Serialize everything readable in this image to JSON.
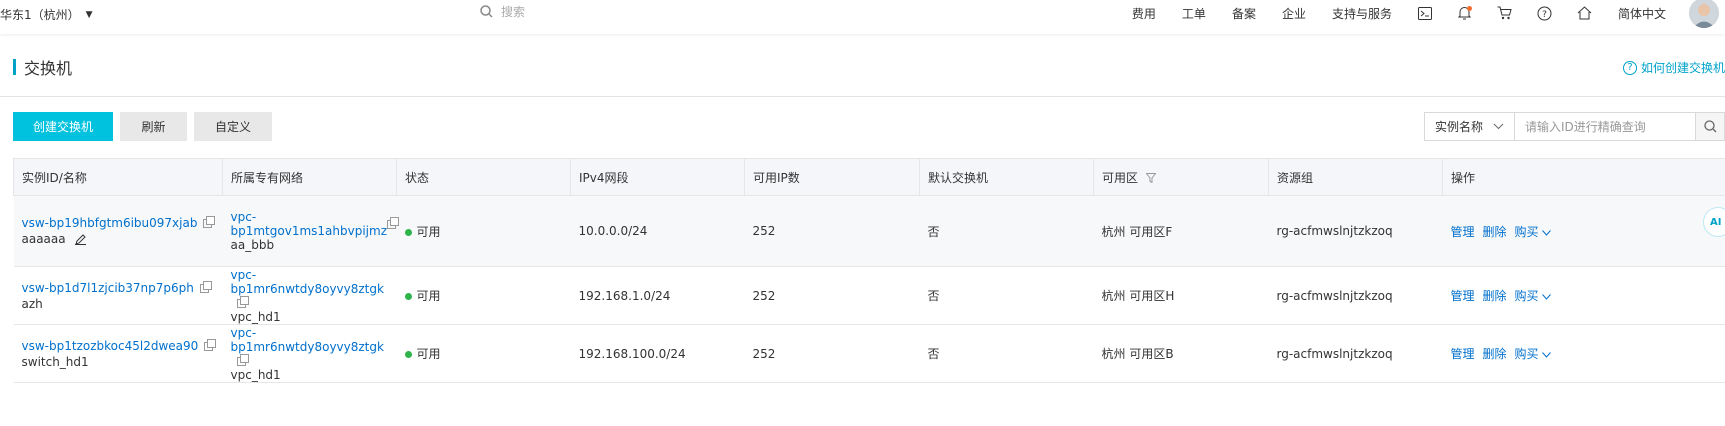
{
  "topbar": {
    "region": "华东1（杭州）",
    "search_placeholder": "搜索",
    "nav": [
      "费用",
      "工单",
      "备案",
      "企业",
      "支持与服务"
    ],
    "lang": "简体中文"
  },
  "header": {
    "title": "交换机",
    "help_link": "如何创建交换机"
  },
  "toolbar": {
    "create": "创建交换机",
    "refresh": "刷新",
    "customize": "自定义",
    "filter_field": "实例名称",
    "filter_placeholder": "请输入ID进行精确查询"
  },
  "table": {
    "columns": [
      "实例ID/名称",
      "所属专有网络",
      "状态",
      "IPv4网段",
      "可用IP数",
      "默认交换机",
      "可用区",
      "资源组",
      "操作"
    ],
    "rows": [
      {
        "id": "vsw-bp19hbfgtm6ibu097xjab",
        "name": "aaaaaa",
        "vpc_id_a": "vpc-",
        "vpc_id_b": "bp1mtgov1ms1ahbvpijmz",
        "vpc_name": "aa_bbb",
        "status": "可用",
        "cidr": "10.0.0.0/24",
        "ips": "252",
        "default": "否",
        "zone": "杭州 可用区F",
        "rg": "rg-acfmwslnjtzkzoq"
      },
      {
        "id": "vsw-bp1d7l1zjcib37np7p6ph",
        "name": "azh",
        "vpc_id": "vpc-bp1mr6nwtdy8oyvy8ztgk",
        "vpc_name": "vpc_hd1",
        "status": "可用",
        "cidr": "192.168.1.0/24",
        "ips": "252",
        "default": "否",
        "zone": "杭州 可用区H",
        "rg": "rg-acfmwslnjtzkzoq"
      },
      {
        "id": "vsw-bp1tzozbkoc45l2dwea90",
        "name": "switch_hd1",
        "vpc_id": "vpc-bp1mr6nwtdy8oyvy8ztgk",
        "vpc_name": "vpc_hd1",
        "status": "可用",
        "cidr": "192.168.100.0/24",
        "ips": "252",
        "default": "否",
        "zone": "杭州 可用区B",
        "rg": "rg-acfmwslnjtzkzoq"
      }
    ],
    "ops": {
      "manage": "管理",
      "delete": "删除",
      "buy": "购买"
    }
  },
  "float_tag": "AI",
  "colors": {
    "primary": "#00c1de",
    "link": "#0070cc",
    "accent": "#00a2ca",
    "status_ok": "#2fb34b"
  }
}
